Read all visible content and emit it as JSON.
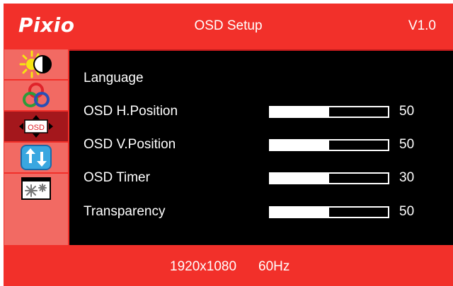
{
  "header": {
    "logo": "Pixio",
    "title": "OSD Setup",
    "version": "V1.0"
  },
  "sidebar": {
    "items": [
      {
        "name": "brightness-contrast-icon",
        "active": false
      },
      {
        "name": "color-settings-icon",
        "active": false
      },
      {
        "name": "osd-setup-icon",
        "label": "OSD",
        "active": true
      },
      {
        "name": "reset-icon",
        "active": false
      },
      {
        "name": "other-settings-icon",
        "active": false
      }
    ]
  },
  "settings": [
    {
      "label": "Language"
    },
    {
      "label": "OSD H.Position",
      "value": "50",
      "level": 0.5
    },
    {
      "label": "OSD V.Position",
      "value": "50",
      "level": 0.5
    },
    {
      "label": "OSD Timer",
      "value": "30",
      "level": 0.5
    },
    {
      "label": "Transparency",
      "value": "50",
      "level": 0.5
    }
  ],
  "footer": {
    "resolution": "1920x1080",
    "refresh_rate": "60Hz"
  },
  "colors": {
    "frame": "#f2302a",
    "panel": "#000000",
    "sidebar_item": "#f26a63",
    "sidebar_active": "#a4171c"
  }
}
